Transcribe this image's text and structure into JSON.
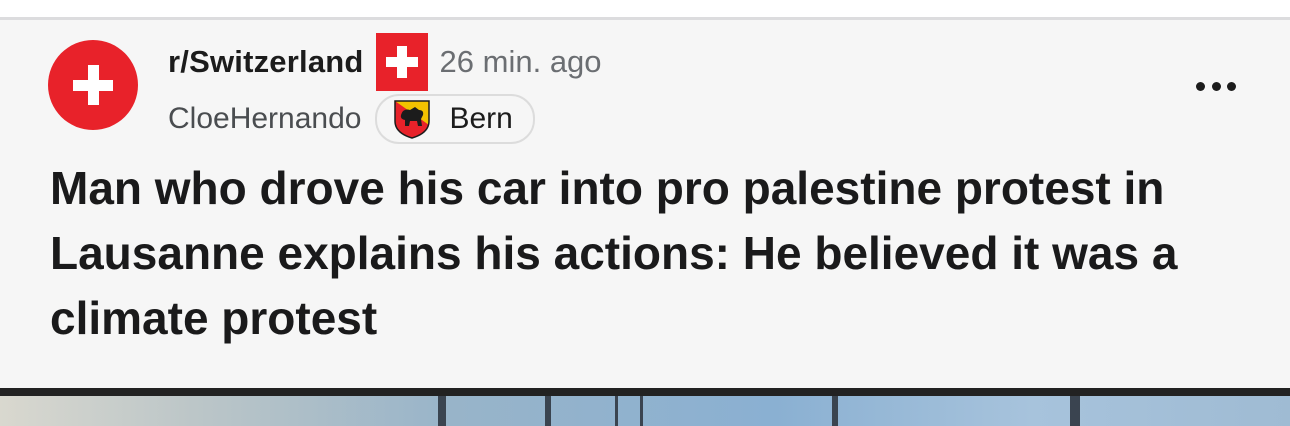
{
  "post": {
    "subreddit": "r/Switzerland",
    "timestamp": "26 min. ago",
    "author": "CloeHernando",
    "flair": "Bern",
    "title": "Man who drove his car into pro palestine protest in Lausanne explains his actions: He believed it was a climate protest"
  },
  "icons": {
    "avatar": "swiss-cross",
    "subreddit_flag": "swiss-flag",
    "flair": "bern-coat-of-arms",
    "menu": "more-options"
  },
  "colors": {
    "swiss_red": "#e8222a",
    "card_background": "#f6f6f6",
    "title_text": "#1a1a1b",
    "meta_text": "#6b6e72"
  }
}
